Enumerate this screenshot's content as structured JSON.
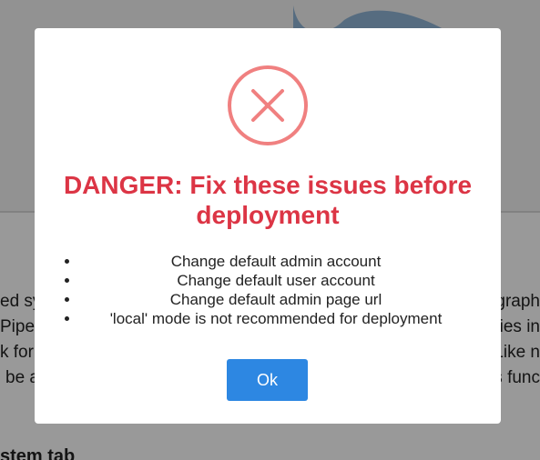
{
  "background": {
    "text_lines": [
      {
        "left": "ed sy",
        "right": "graph"
      },
      {
        "left": "PipeF",
        "right": "ies in"
      },
      {
        "left": "k for",
        "right": "Like n"
      },
      {
        "left": "be a",
        "right": "s func"
      }
    ],
    "heading_fragment": "stem tab"
  },
  "modal": {
    "icon": "error-circle-x-icon",
    "title": "DANGER: Fix these issues before deployment",
    "issues": [
      "Change default admin account",
      "Change default user account",
      "Change default admin page url",
      "'local' mode is not recommended for deployment"
    ],
    "ok_label": "Ok"
  },
  "colors": {
    "danger": "#dc3545",
    "icon_stroke": "#f08080",
    "primary": "#2d87e2"
  }
}
